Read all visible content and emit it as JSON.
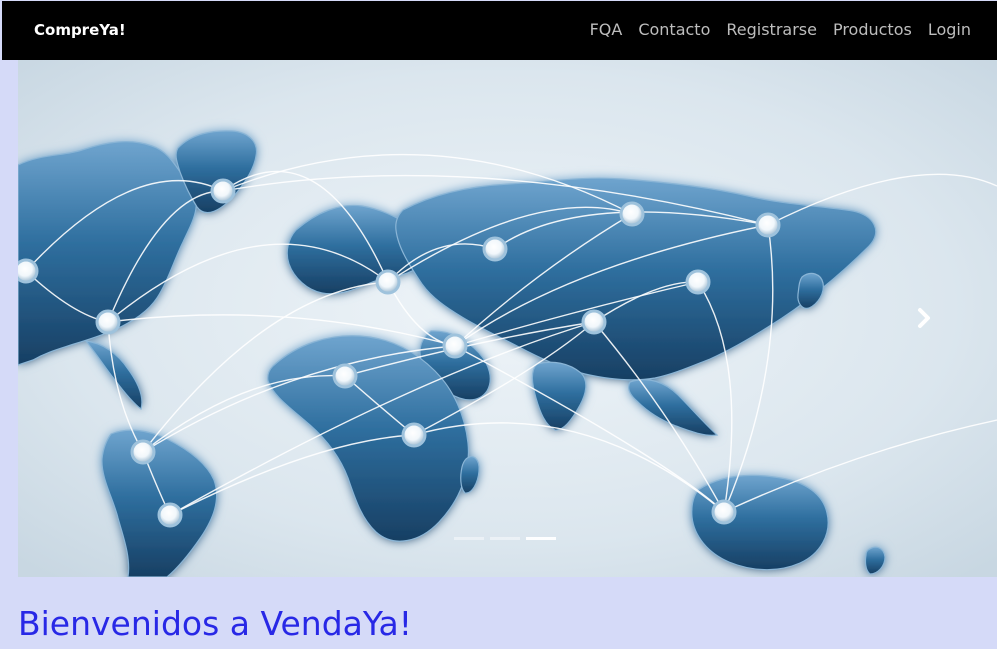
{
  "navbar": {
    "brand": "CompreYa!",
    "links": [
      "FQA",
      "Contacto",
      "Registrarse",
      "Productos",
      "Login"
    ]
  },
  "carousel": {
    "image": "world-map-network",
    "slide_count": 3,
    "active_slide": 3,
    "next_icon": "chevron-right-icon"
  },
  "main": {
    "heading": "Bienvenidos a VendaYa!"
  },
  "colors": {
    "page_bg": "#d5daf8",
    "navbar_bg": "#000000",
    "nav_link": "#bdbdbd",
    "heading": "#2828e6",
    "map_blue": "#2f6f9f",
    "map_dark": "#173f63"
  }
}
